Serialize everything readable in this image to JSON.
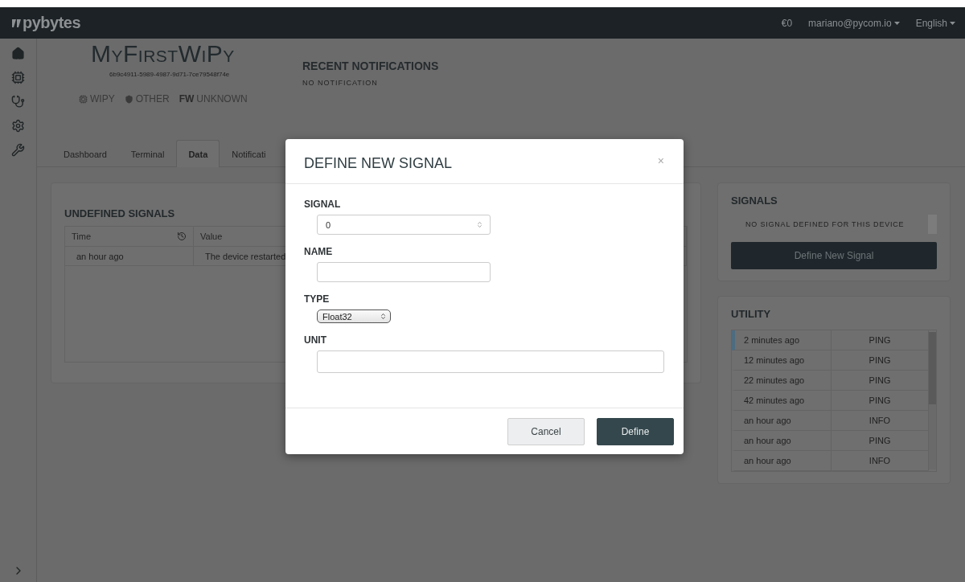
{
  "topbar": {
    "logo": "pybytes",
    "balance": "€0",
    "user_menu": "mariano@pycom.io",
    "language_menu": "English"
  },
  "device": {
    "name": "MyFirstWiPy",
    "id": "6b9c4911-5989-4987-9d71-7ce79548f74e",
    "tags": [
      {
        "kind": "chip",
        "text": "WIPY"
      },
      {
        "kind": "shield",
        "text": "OTHER"
      },
      {
        "kind": "prefix",
        "label": "FW",
        "text": "UNKNOWN"
      }
    ]
  },
  "notifications": {
    "title": "RECENT NOTIFICATIONS",
    "empty": "NO NOTIFICATION"
  },
  "tabs": [
    {
      "label": "Dashboard",
      "selected": false
    },
    {
      "label": "Terminal",
      "selected": false
    },
    {
      "label": "Data",
      "selected": true
    },
    {
      "label": "Notificati",
      "selected": false
    }
  ],
  "undefined_signals": {
    "title": "UNDEFINED SIGNALS",
    "columns": [
      "Time",
      "Value"
    ],
    "rows": [
      [
        "an hour ago",
        "The device restarted"
      ]
    ]
  },
  "signals": {
    "title": "SIGNALS",
    "empty": "NO SIGNAL DEFINED FOR THIS DEVICE",
    "button": "Define New Signal"
  },
  "utility": {
    "title": "UTILITY",
    "rows": [
      {
        "time": "2 minutes ago",
        "type": "PING",
        "selected": true
      },
      {
        "time": "12 minutes ago",
        "type": "PING",
        "selected": false
      },
      {
        "time": "22 minutes ago",
        "type": "PING",
        "selected": false
      },
      {
        "time": "42 minutes ago",
        "type": "PING",
        "selected": false
      },
      {
        "time": "an hour ago",
        "type": "INFO",
        "selected": false
      },
      {
        "time": "an hour ago",
        "type": "PING",
        "selected": false
      },
      {
        "time": "an hour ago",
        "type": "INFO",
        "selected": false
      }
    ]
  },
  "dialog": {
    "title": "DEFINE NEW SIGNAL",
    "close": "×",
    "fields": [
      {
        "kind": "number",
        "label": "SIGNAL",
        "value": "0"
      },
      {
        "kind": "text",
        "label": "NAME"
      },
      {
        "kind": "select",
        "label": "TYPE",
        "value": "Float32"
      },
      {
        "kind": "wide",
        "label": "UNIT"
      }
    ],
    "buttons": [
      {
        "kind": "secondary",
        "label": "Cancel"
      },
      {
        "kind": "primary",
        "label": "Define"
      }
    ]
  }
}
